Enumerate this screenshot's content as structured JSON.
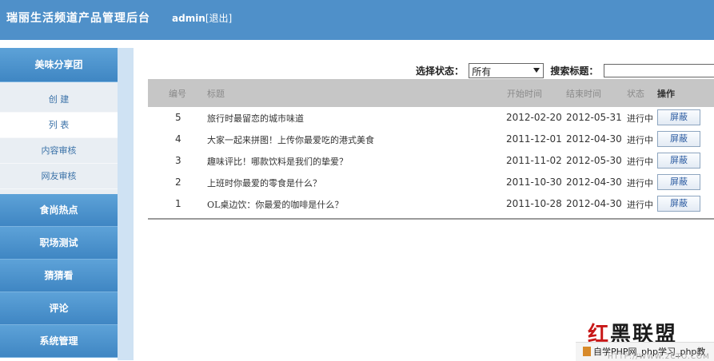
{
  "header": {
    "title": "瑞丽生活频道产品管理后台",
    "user": "admin",
    "logout": "[退出]"
  },
  "sidebar": {
    "groups": [
      {
        "label": "美味分享团"
      },
      {
        "label": "食尚热点"
      },
      {
        "label": "职场测试"
      },
      {
        "label": "猜猜看"
      },
      {
        "label": "评论"
      },
      {
        "label": "系统管理"
      }
    ],
    "subitems": [
      {
        "label": "创 建"
      },
      {
        "label": "列 表"
      },
      {
        "label": "内容审核"
      },
      {
        "label": "网友审核"
      }
    ]
  },
  "filter": {
    "status_label": "选择状态：",
    "status_value": "所有",
    "search_label": "搜索标题：",
    "search_value": ""
  },
  "table": {
    "headers": {
      "id": "编号",
      "title": "标题",
      "start": "开始时间",
      "end": "结束时间",
      "status": "状态",
      "op": "操作"
    },
    "rows": [
      {
        "id": "5",
        "title": "旅行时最留恋的城市味道",
        "start": "2012-02-20",
        "end": "2012-05-31",
        "status": "进行中",
        "action": "屏蔽"
      },
      {
        "id": "4",
        "title": "大家一起来拼图！上传你最爱吃的港式美食",
        "start": "2011-12-01",
        "end": "2012-04-30",
        "status": "进行中",
        "action": "屏蔽"
      },
      {
        "id": "3",
        "title": "趣味评比！哪款饮料是我们的挚爱？",
        "start": "2011-11-02",
        "end": "2012-05-30",
        "status": "进行中",
        "action": "屏蔽"
      },
      {
        "id": "2",
        "title": "上班时你最爱的零食是什么？",
        "start": "2011-10-30",
        "end": "2012-04-30",
        "status": "进行中",
        "action": "屏蔽"
      },
      {
        "id": "1",
        "title": "OL桌边饮：你最爱的咖啡是什么？",
        "start": "2011-10-28",
        "end": "2012-04-30",
        "status": "进行中",
        "action": "屏蔽"
      }
    ]
  },
  "watermark": {
    "logo_a": "红",
    "logo_b": "黑联盟",
    "strip": "自学PHP网_php学习_php教",
    "url": "HTTP://WWW.2CTO.COM"
  },
  "colors": {
    "header_bg": "#4f90c9",
    "sidebar_group": "#4a92cf",
    "sidebar_stripe": "#cfe2f3",
    "table_header": "#c6c6c6"
  }
}
